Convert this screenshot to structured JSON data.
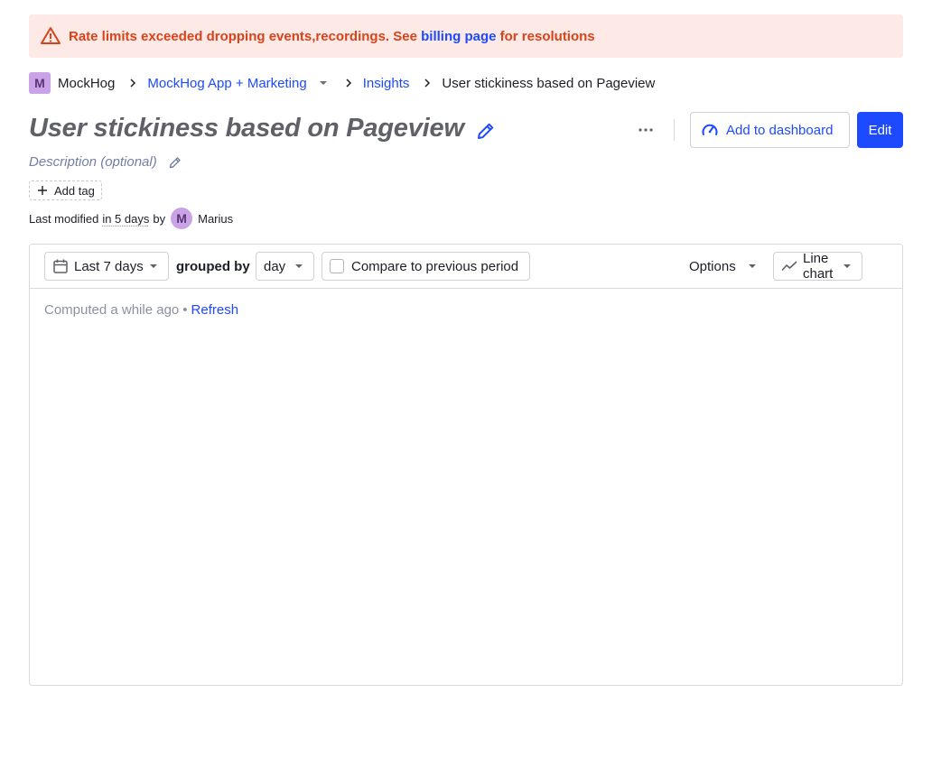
{
  "alert": {
    "message_prefix": "Rate limits exceeded dropping events,recordings. See ",
    "link_text": "billing page",
    "message_suffix": " for resolutions",
    "color": "#d9421a",
    "background": "#fde9e5"
  },
  "breadcrumb": {
    "org_initial": "M",
    "org_name": "MockHog",
    "project_name": "MockHog App + Marketing",
    "section": "Insights",
    "current": "User stickiness based on Pageview"
  },
  "insight": {
    "title": "User stickiness based on Pageview",
    "description_placeholder": "Description (optional)",
    "add_tag_label": "Add tag",
    "add_to_dashboard_label": "Add to dashboard",
    "edit_label": "Edit",
    "modified": {
      "prefix": "Last modified",
      "when": "in 5 days",
      "by": "by",
      "user_initial": "M",
      "user_name": "Marius"
    }
  },
  "toolbar": {
    "date_range": "Last 7 days",
    "grouped_by_label": "grouped by",
    "interval": "day",
    "compare_label": "Compare to previous period",
    "options_label": "Options",
    "chart_type": "Line chart"
  },
  "status": {
    "computed_text": "Computed a while ago",
    "separator": "•",
    "refresh_label": "Refresh"
  },
  "colors": {
    "primary": "#1d4aff",
    "muted_text": "#747ea2",
    "avatar_bg": "#c9a3e6"
  }
}
